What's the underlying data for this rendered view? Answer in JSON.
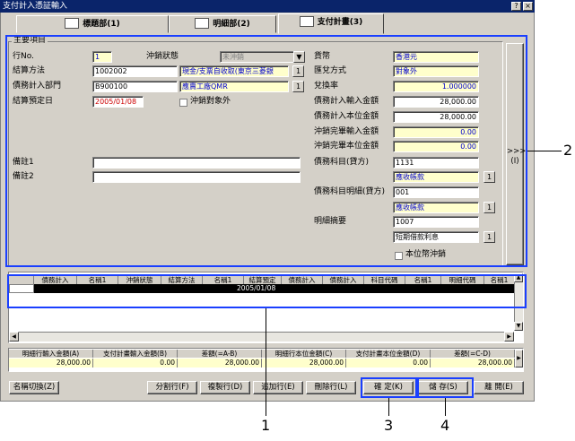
{
  "window": {
    "title": "支付計入憑証輸入",
    "btn_help": "?",
    "btn_close": "×"
  },
  "tabs": [
    {
      "label": "標題部(1)"
    },
    {
      "label": "明細部(2)"
    },
    {
      "label": "支付計畫(3)"
    }
  ],
  "main_section": {
    "title": "主要項目",
    "row_no_label": "行No.",
    "row_no_value": "1",
    "write_off_status_label": "沖銷狀態",
    "write_off_status_value": "未沖銷",
    "settle_method_label": "結算方法",
    "settle_method_code": "1002002",
    "settle_method_name": "現金/支票自收取(東京三菱銀",
    "dept_label": "債務計入部門",
    "dept_code": "B900100",
    "dept_name": "應賣工廠QMR",
    "due_date_label": "結算預定日",
    "due_date_value": "2005/01/08",
    "exclude_label": "沖銷對象外",
    "currency_label": "貨幣",
    "currency_value": "香港元",
    "exchange_method_label": "匯兌方式",
    "exchange_method_value": "對象外",
    "exchange_rate_label": "兌換率",
    "exchange_rate_value": "1.000000",
    "input_amount_label": "債務計入輸入金額",
    "input_amount_value": "28,000.00",
    "local_amount_label": "債務計入本位金額",
    "local_amount_value": "28,000.00",
    "done_input_label": "沖銷完畢輸入金額",
    "done_input_value": "0.00",
    "done_local_label": "沖銷完畢本位金額",
    "done_local_value": "0.00",
    "note1_label": "備註1",
    "note2_label": "備註2",
    "account_label": "債務科目(貸方)",
    "account_code": "1131",
    "account_name": "應收帳款",
    "sub_account_label": "債務科目明細(貸方)",
    "sub_account_code": "001",
    "sub_account_name": "應收帳款",
    "summary_label": "明細摘要",
    "summary_code": "1007",
    "summary_name": "短期借款利息",
    "local_write_off_label": "本位幣沖銷",
    "lookup_btn": "1",
    "expand_btn": ">>>",
    "expand_sub": "(I)"
  },
  "grid": {
    "headers": [
      "債務計入",
      "名稱1",
      "沖銷狀態",
      "結算方法",
      "名稱1",
      "結算預定",
      "債務計入",
      "債務計入",
      "科目代碼",
      "名稱1",
      "明細代碼",
      "名稱1"
    ],
    "row_date": "2005/01/08"
  },
  "summary": {
    "headers": [
      "明細行輸入金額(A)",
      "支付計畫輸入金額(B)",
      "差額(=A-B)",
      "明細行本位金額(C)",
      "支付計畫本位金額(D)",
      "差額(=C-D)"
    ],
    "values": [
      "28,000.00",
      "0.00",
      "28,000.00",
      "28,000.00",
      "0.00",
      "28,000.00"
    ]
  },
  "buttons": {
    "name_switch": "名稱切換(Z)",
    "split_row": "分割行(F)",
    "copy_row": "複製行(D)",
    "add_row": "追加行(E)",
    "delete_row": "刪除行(L)",
    "confirm": "確 定(K)",
    "save": "儲 存(S)",
    "close": "離 開(E)"
  },
  "callouts": [
    "1",
    "2",
    "3",
    "4"
  ],
  "colors": {
    "highlight": "#1a3fff",
    "field_yellow": "#ffffcc",
    "title_bar": "#0a246a"
  }
}
